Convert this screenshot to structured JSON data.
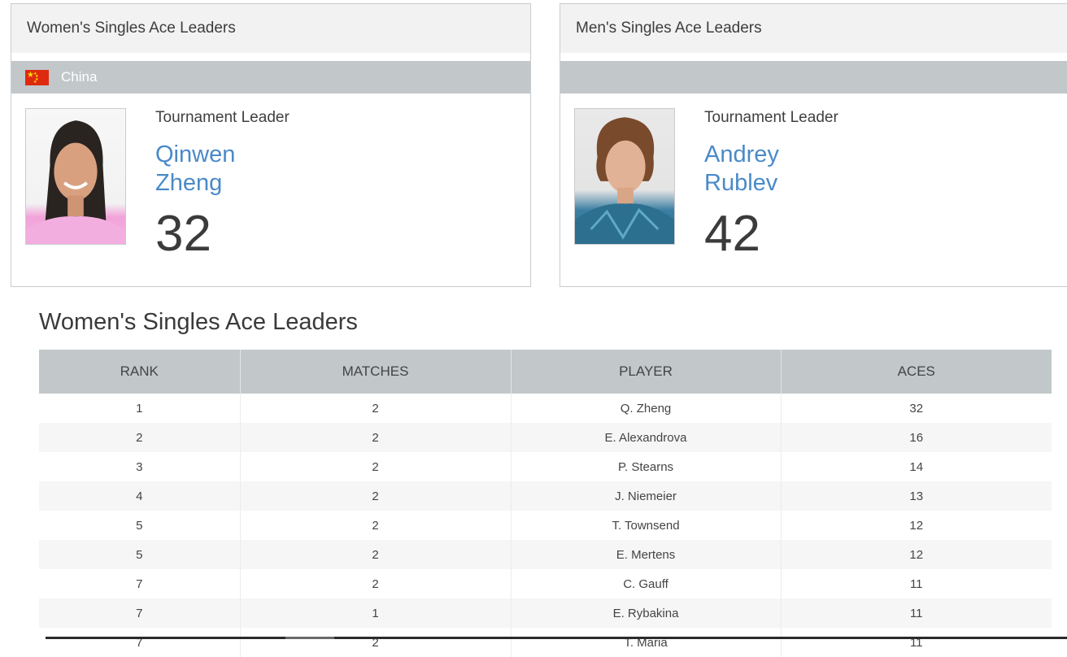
{
  "women_card": {
    "title": "Women's Singles Ace Leaders",
    "country": "China",
    "leader_label": "Tournament Leader",
    "first_name": "Qinwen",
    "last_name": "Zheng",
    "value": "32"
  },
  "men_card": {
    "title": "Men's Singles Ace Leaders",
    "country": "",
    "leader_label": "Tournament Leader",
    "first_name": "Andrey",
    "last_name": "Rublev",
    "value": "42"
  },
  "table": {
    "title": "Women's Singles Ace Leaders",
    "headers": [
      "RANK",
      "MATCHES",
      "PLAYER",
      "ACES"
    ],
    "rows": [
      [
        "1",
        "2",
        "Q. Zheng",
        "32"
      ],
      [
        "2",
        "2",
        "E. Alexandrova",
        "16"
      ],
      [
        "3",
        "2",
        "P. Stearns",
        "14"
      ],
      [
        "4",
        "2",
        "J. Niemeier",
        "13"
      ],
      [
        "5",
        "2",
        "T. Townsend",
        "12"
      ],
      [
        "5",
        "2",
        "E. Mertens",
        "12"
      ],
      [
        "7",
        "2",
        "C. Gauff",
        "11"
      ],
      [
        "7",
        "1",
        "E. Rybakina",
        "11"
      ],
      [
        "7",
        "2",
        "T. Maria",
        "11"
      ]
    ]
  },
  "colors": {
    "accent": "#4a8ac8",
    "bar": "#c2c7ca",
    "header_bg": "#f2f2f2"
  }
}
